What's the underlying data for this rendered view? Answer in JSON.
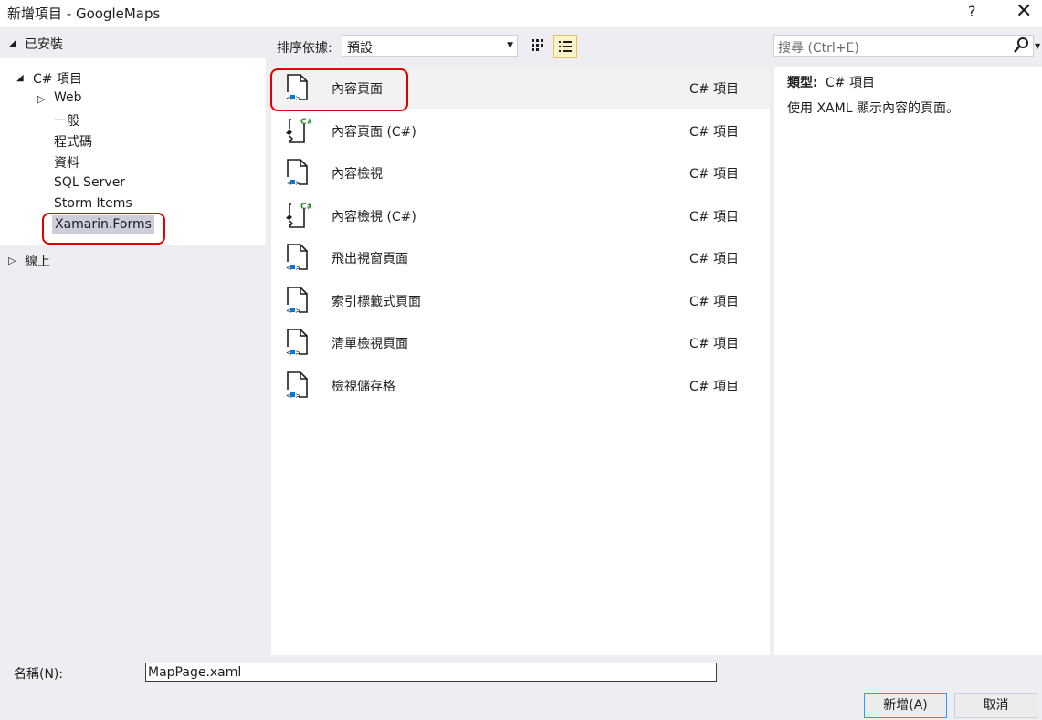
{
  "window": {
    "title": "新增項目 - GoogleMaps",
    "help": "?",
    "close": "✕"
  },
  "tree": {
    "installed": "已安裝",
    "csharp": "C# 項目",
    "web": "Web",
    "items": [
      "一般",
      "程式碼",
      "資料",
      "SQL Server",
      "Storm Items"
    ],
    "selected": "Xamarin.Forms",
    "online": "線上"
  },
  "toolbar": {
    "sort_label": "排序依據:",
    "sort_value": "預設",
    "search_placeholder": "搜尋 (Ctrl+E)"
  },
  "templates": [
    {
      "name": "內容頁面",
      "category": "C# 項目",
      "icon": "xaml-page-icon"
    },
    {
      "name": "內容頁面 (C#)",
      "category": "C# 項目",
      "icon": "csharp-page-icon"
    },
    {
      "name": "內容檢視",
      "category": "C# 項目",
      "icon": "xaml-page-icon"
    },
    {
      "name": "內容檢視 (C#)",
      "category": "C# 項目",
      "icon": "csharp-page-icon"
    },
    {
      "name": "飛出視窗頁面",
      "category": "C# 項目",
      "icon": "xaml-page-icon"
    },
    {
      "name": "索引標籤式頁面",
      "category": "C# 項目",
      "icon": "xaml-page-icon"
    },
    {
      "name": "清單檢視頁面",
      "category": "C# 項目",
      "icon": "xaml-page-icon"
    },
    {
      "name": "檢視儲存格",
      "category": "C# 項目",
      "icon": "xaml-page-icon"
    }
  ],
  "details": {
    "type_label": "類型:",
    "type_value": "C# 項目",
    "description": "使用 XAML 顯示內容的頁面。"
  },
  "bottom": {
    "name_label": "名稱(N):",
    "name_value": "MapPage.xaml",
    "add_button": "新增(A)",
    "cancel_button": "取消"
  },
  "colors": {
    "highlight": "#e00000",
    "accent": "#3399ff",
    "csharp_green": "#2e8b2e"
  }
}
